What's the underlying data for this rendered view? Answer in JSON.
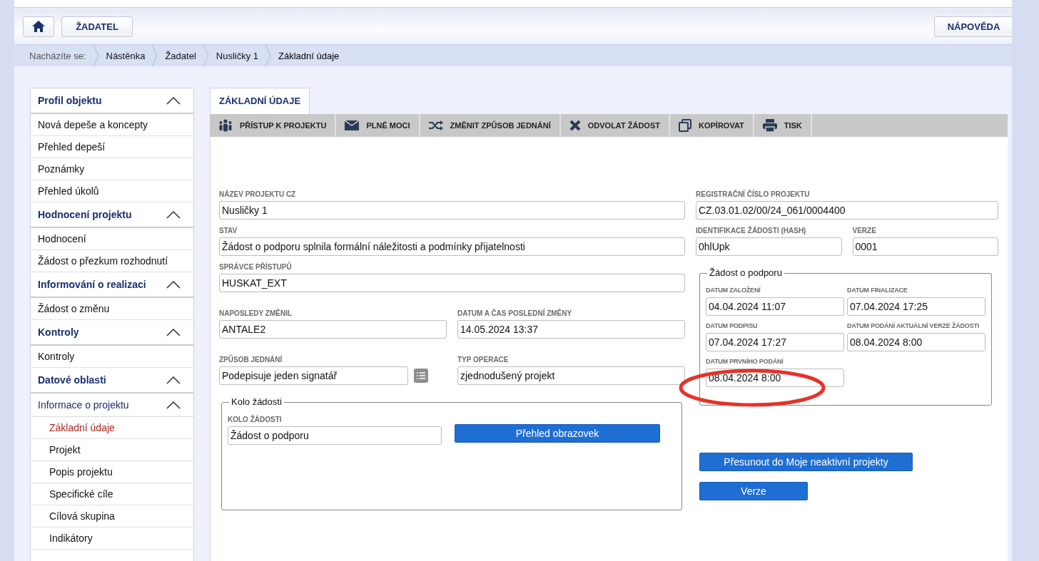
{
  "header": {
    "applicant_button": "ŽADATEL",
    "help_button": "NÁPOVĚDA"
  },
  "breadcrumb": {
    "label": "Nacházíte se:",
    "items": [
      {
        "label": "Nástěnka",
        "selected": false
      },
      {
        "label": "Žadatel",
        "selected": false
      },
      {
        "label": "Nusličky 1",
        "selected": false
      },
      {
        "label": "Základní údaje",
        "selected": true
      }
    ]
  },
  "sidebar": {
    "sections": [
      {
        "title": "Profil objektu",
        "expanded": true,
        "items": [
          {
            "label": "Nová depeše a koncepty",
            "selected": false
          },
          {
            "label": "Přehled depeší",
            "selected": false
          },
          {
            "label": "Poznámky",
            "selected": false
          },
          {
            "label": "Přehled úkolů",
            "selected": false
          }
        ]
      },
      {
        "title": "Hodnocení projektu",
        "expanded": true,
        "items": [
          {
            "label": "Hodnocení",
            "selected": false
          },
          {
            "label": "Žádost o přezkum rozhodnutí",
            "selected": false
          }
        ]
      },
      {
        "title": "Informování o realizaci",
        "expanded": true,
        "items": [
          {
            "label": "Žádost o změnu",
            "selected": false
          }
        ]
      },
      {
        "title": "Kontroly",
        "expanded": true,
        "items": [
          {
            "label": "Kontroly",
            "selected": false
          }
        ]
      },
      {
        "title": "Datové oblasti",
        "expanded": true,
        "items": [
          {
            "label": "Informace o projektu",
            "expanded": true,
            "children": [
              {
                "label": "Základní údaje",
                "selected": true
              },
              {
                "label": "Projekt",
                "selected": false
              },
              {
                "label": "Popis projektu",
                "selected": false
              },
              {
                "label": "Specifické cíle",
                "selected": false
              },
              {
                "label": "Cílová skupina",
                "selected": false
              },
              {
                "label": "Indikátory",
                "selected": false
              }
            ]
          }
        ]
      }
    ]
  },
  "tabs": [
    {
      "label": "ZÁKLADNÍ ÚDAJE",
      "selected": true
    }
  ],
  "toolbar": [
    {
      "kind": "people",
      "label": "PŘÍSTUP K PROJEKTU"
    },
    {
      "kind": "mail",
      "label": "PLNÉ MOCI"
    },
    {
      "kind": "shuffle",
      "label": "ZMĚNIT ZPŮSOB JEDNÁNÍ"
    },
    {
      "kind": "cross",
      "label": "ODVOLAT ŽÁDOST"
    },
    {
      "kind": "copy",
      "label": "KOPÍROVAT"
    },
    {
      "kind": "print",
      "label": "TISK"
    }
  ],
  "left_rows": [
    [
      {
        "kind": "text",
        "label": "NÁZEV PROJEKTU CZ",
        "value": "Nusličky 1"
      }
    ],
    [
      {
        "kind": "text",
        "label": "STAV",
        "value": "Žádost o podporu splnila formální náležitosti a podmínky přijatelnosti"
      }
    ],
    [
      {
        "kind": "text",
        "label": "SPRÁVCE PŘÍSTUPŮ",
        "value": "HUSKAT_EXT"
      }
    ],
    [
      {
        "kind": "text",
        "label": "NAPOSLEDY ZMĚNIL",
        "value": "ANTALE2"
      },
      {
        "kind": "text",
        "label": "DATUM A ČAS POSLEDNÍ ZMĚNY",
        "value": "14.05.2024 13:37"
      }
    ],
    [
      {
        "kind": "list_select",
        "label": "ZPŮSOB JEDNÁNÍ",
        "value": "Podepisuje jeden signatář"
      },
      {
        "kind": "text",
        "label": "TYP OPERACE",
        "value": "zjednodušený projekt"
      }
    ]
  ],
  "round_group": {
    "legend": "Kolo žádosti",
    "field": {
      "label": "KOLO ŽÁDOSTI",
      "value": "Žádost o podporu"
    },
    "button": "Přehled obrazovek"
  },
  "right_rows": [
    [
      {
        "label": "REGISTRAČNÍ ČÍSLO PROJEKTU",
        "value": "CZ.03.01.02/00/24_061/0004400"
      }
    ],
    [
      {
        "label": "IDENTIFIKACE ŽÁDOSTI (HASH)",
        "value": "0hlUpk"
      },
      {
        "label": "VERZE",
        "value": "0001"
      }
    ]
  ],
  "application_group": {
    "legend": "Žádost o podporu",
    "fields": [
      {
        "label": "DATUM ZALOŽENÍ",
        "value": "04.04.2024 11:07",
        "highlighted": false
      },
      {
        "label": "DATUM FINALIZACE",
        "value": "07.04.2024 17:25",
        "highlighted": false
      },
      {
        "label": "DATUM PODPISU",
        "value": "07.04.2024 17:27",
        "highlighted": false
      },
      {
        "label": "DATUM PODÁNÍ AKTUÁLNÍ VERZE ŽÁDOSTI",
        "value": "08.04.2024 8:00",
        "highlighted": false
      },
      {
        "label": "DATUM PRVNÍHO PODÁNÍ",
        "value": "08.04.2024 8:00",
        "highlighted": true
      }
    ]
  },
  "actions": [
    "Přesunout do Moje neaktivní projekty",
    "Verze"
  ]
}
